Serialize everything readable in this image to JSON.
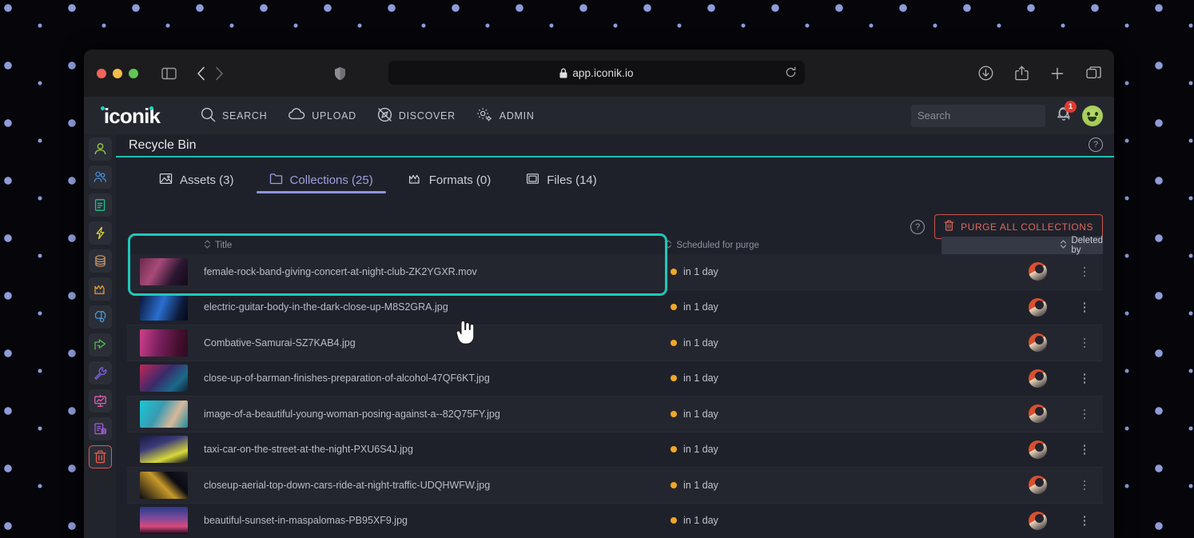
{
  "browser": {
    "url": "app.iconik.io",
    "lock_icon": "lock-icon",
    "reload_icon": "reload-icon",
    "sidebar_toggle_icon": "sidebar-toggle-icon",
    "back_icon": "chevron-left-icon",
    "forward_icon": "chevron-right-icon",
    "shield_icon": "shield-icon",
    "download_icon": "download-icon",
    "share_icon": "share-icon",
    "new_tab_icon": "plus-icon",
    "tabs_icon": "tab-overview-icon"
  },
  "appnav": {
    "logo": "iconik",
    "items": [
      {
        "label": "SEARCH",
        "icon": "search-icon"
      },
      {
        "label": "UPLOAD",
        "icon": "cloud-upload-icon"
      },
      {
        "label": "DISCOVER",
        "icon": "compass-off-icon"
      },
      {
        "label": "ADMIN",
        "icon": "gear-icon"
      }
    ],
    "search": {
      "placeholder": "Search",
      "value": ""
    },
    "notifications": {
      "count": "1",
      "icon": "bell-icon"
    },
    "avatar": "user-avatar"
  },
  "sidebar": {
    "items": [
      {
        "name": "users",
        "icon": "person-icon",
        "color": "#9ccc4a",
        "active": false
      },
      {
        "name": "groups",
        "icon": "people-group-icon",
        "color": "#4a8fd4",
        "active": false
      },
      {
        "name": "metadata",
        "icon": "document-lines-icon",
        "color": "#20bf8f",
        "active": false
      },
      {
        "name": "automations",
        "icon": "lightning-bolt-icon",
        "color": "#d7d53c",
        "active": false
      },
      {
        "name": "storages",
        "icon": "database-icon",
        "color": "#c2956a",
        "active": false
      },
      {
        "name": "transcode",
        "icon": "waveform-factory-icon",
        "color": "#e09a36",
        "active": false
      },
      {
        "name": "ai",
        "icon": "brain-gear-icon",
        "color": "#4a9fe0",
        "active": false
      },
      {
        "name": "shares",
        "icon": "share-arrow-icon",
        "color": "#4fc04f",
        "active": false
      },
      {
        "name": "settings",
        "icon": "wrench-icon",
        "color": "#7a5fd4",
        "active": false
      },
      {
        "name": "analytics",
        "icon": "presentation-chart-icon",
        "color": "#e05fb0",
        "active": false
      },
      {
        "name": "logs",
        "icon": "document-database-icon",
        "color": "#a05fd4",
        "active": false
      },
      {
        "name": "recycle-bin",
        "icon": "trash-icon",
        "color": "#e05a52",
        "active": true
      }
    ]
  },
  "page": {
    "title": "Recycle Bin",
    "help_icon": "help-circle-icon"
  },
  "tabs": [
    {
      "label": "Assets (3)",
      "icon": "image-icon",
      "active": false
    },
    {
      "label": "Collections (25)",
      "icon": "folder-icon",
      "active": true
    },
    {
      "label": "Formats (0)",
      "icon": "waveform-icon",
      "active": false
    },
    {
      "label": "Files (14)",
      "icon": "file-window-icon",
      "active": false
    }
  ],
  "toolbar": {
    "help_icon": "help-circle-icon",
    "purge_label": "PURGE ALL COLLECTIONS",
    "purge_icon": "trash-icon"
  },
  "table": {
    "columns": [
      {
        "label": "Title",
        "sort_icon": "sort-icon"
      },
      {
        "label": "Scheduled for purge",
        "sort_icon": "sort-icon"
      },
      {
        "label": "Deleted by",
        "sort_icon": "sort-icon"
      }
    ],
    "rows": [
      {
        "title": "female-rock-band-giving-concert-at-night-club-ZK2YGXR.mov",
        "scheduled": "in 1 day",
        "thumb": "linear-gradient(120deg,#6b2a4a,#a84a7a 35%,#2a1630 70%,#120a18)"
      },
      {
        "title": "electric-guitar-body-in-the-dark-close-up-M8S2GRA.jpg",
        "scheduled": "in 1 day",
        "thumb": "linear-gradient(110deg,#0a1230,#2a6fd0 45%,#0c1a3a 80%,#050a1c)"
      },
      {
        "title": "Combative-Samurai-SZ7KAB4.jpg",
        "scheduled": "in 1 day",
        "thumb": "linear-gradient(100deg,#d0408a,#7a2060 40%,#4a1030 75%,#2a0a20)"
      },
      {
        "title": "close-up-of-barman-finishes-preparation-of-alcohol-47QF6KT.jpg",
        "scheduled": "in 1 day",
        "thumb": "linear-gradient(135deg,#c2265a,#3a2a6a 45%,#1a6a8a 75%,#102030)"
      },
      {
        "title": "image-of-a-beautiful-young-woman-posing-against-a--82Q75FY.jpg",
        "scheduled": "in 1 day",
        "thumb": "linear-gradient(120deg,#18c8d8,#3a9ab0 40%,#d8b89a 70%,#1a8a9a)"
      },
      {
        "title": "taxi-car-on-the-street-at-the-night-PXU6S4J.jpg",
        "scheduled": "in 1 day",
        "thumb": "linear-gradient(160deg,#1a1a3a,#3a3a7a 35%,#d8d83a 72%,#0a0a1a)"
      },
      {
        "title": "closeup-aerial-top-down-cars-ride-at-night-traffic-UDQHWFW.jpg",
        "scheduled": "in 1 day",
        "thumb": "linear-gradient(45deg,#0a0a10,#c89a2a 48%,#0a0a12 70%,#1a1a22)"
      },
      {
        "title": "beautiful-sunset-in-maspalomas-PB95XF9.jpg",
        "scheduled": "in 1 day",
        "thumb": "linear-gradient(180deg,#2a3a8a,#7a4a9a 40%,#d84a7a 72%,#1a0a20)"
      }
    ]
  },
  "cursor": {
    "icon": "pointing-hand-cursor"
  }
}
